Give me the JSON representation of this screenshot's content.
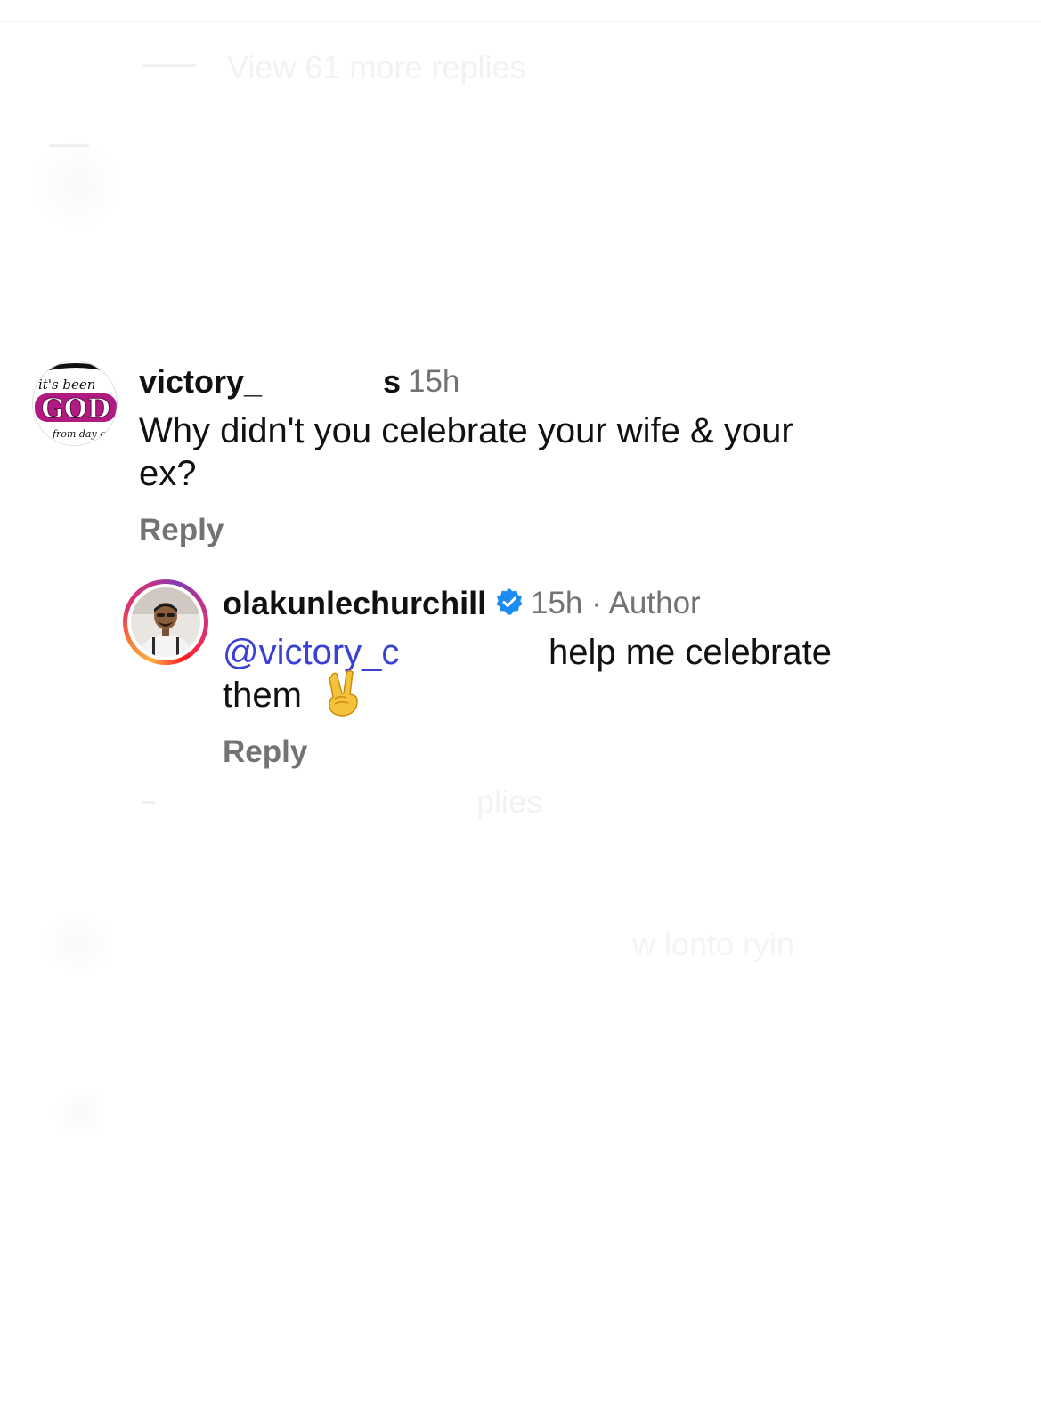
{
  "comments": [
    {
      "username": "victory_",
      "username_tail": "s",
      "time": "15h",
      "avatar": {
        "icon": "its-been-god-avatar",
        "line1": "it's been",
        "line2": "GOD",
        "line3": "from day o"
      },
      "text_line1": "Why didn't you celebrate your wife & your",
      "text_line2": "ex?",
      "reply_label": "Reply"
    },
    {
      "username": "olakunlechurchill",
      "verified": true,
      "time": "15h · Author",
      "mention": "@victory_c",
      "text_rest": "help me celebrate",
      "text_line2": "them",
      "emoji": "✌️",
      "reply_label": "Reply"
    }
  ],
  "faded": {
    "view_more": "View 61 more replies",
    "view_replies": "plies",
    "bottom_text": "w lonto ryin"
  },
  "colors": {
    "username": "#111111",
    "meta_gray": "#737373",
    "mention_blue": "#3a3fd6",
    "verified_blue": "#1d8cf0",
    "god_magenta": "#b21a83"
  }
}
